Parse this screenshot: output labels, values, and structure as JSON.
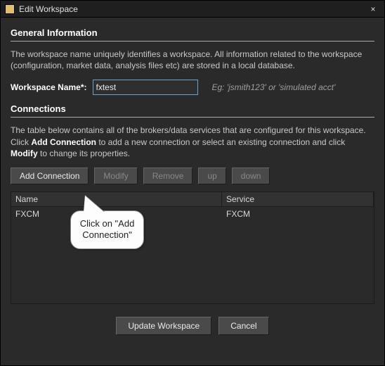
{
  "window": {
    "title": "Edit Workspace",
    "close_glyph": "×"
  },
  "general": {
    "header": "General Information",
    "desc": "The workspace name uniquely identifies a workspace. All information related to the workspace (configuration, market data, analysis files etc) are stored in a local database.",
    "name_label": "Workspace Name*:",
    "name_value": "fxtest",
    "name_hint": "Eg: 'jsmith123' or 'simulated acct'"
  },
  "connections": {
    "header": "Connections",
    "desc_pre": "The table below contains all of the brokers/data services that are configured for this workspace. Click ",
    "desc_bold1": "Add Connection",
    "desc_mid": " to add a new connection or select an existing connection and click ",
    "desc_bold2": "Modify",
    "desc_post": " to change its properties.",
    "buttons": {
      "add": "Add Connection",
      "modify": "Modify",
      "remove": "Remove",
      "up": "up",
      "down": "down"
    },
    "table": {
      "col_name": "Name",
      "col_service": "Service",
      "rows": [
        {
          "name": "FXCM",
          "service": "FXCM"
        }
      ]
    }
  },
  "footer": {
    "update": "Update Workspace",
    "cancel": "Cancel"
  },
  "callout": {
    "text": "Click on \"Add Connection\""
  }
}
